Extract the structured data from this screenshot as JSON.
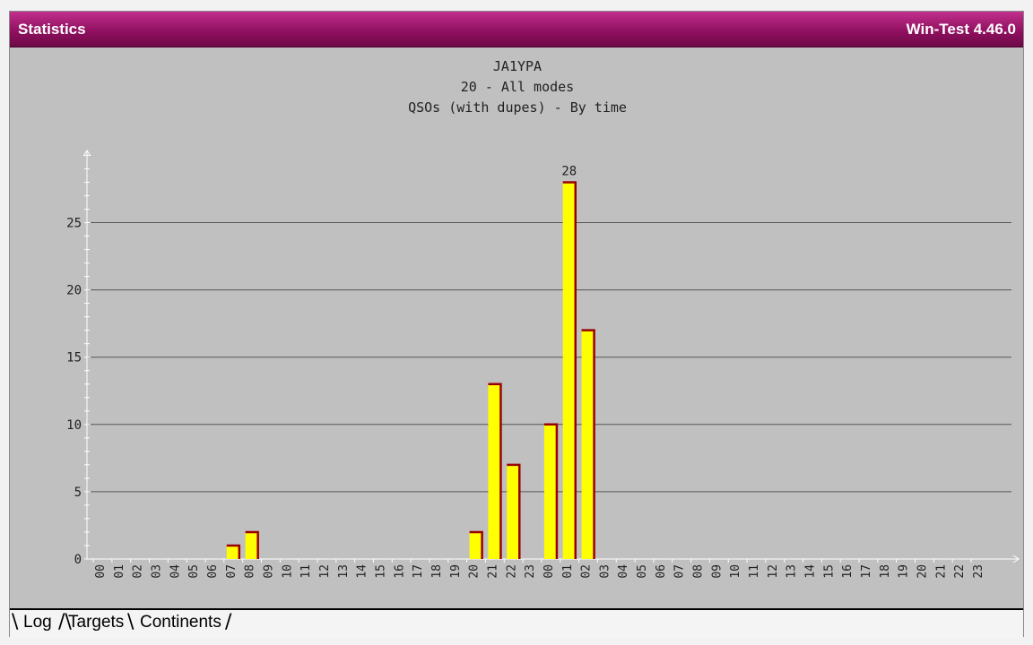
{
  "window": {
    "title": "Statistics",
    "version": "Win-Test 4.46.0"
  },
  "tabs": [
    "Log",
    "Targets",
    "Continents"
  ],
  "colors": {
    "bar_fill": "#ffff00",
    "bar_edge": "#9a0000",
    "background": "#c0c0c0",
    "titlebar": "#a31872"
  },
  "chart_data": {
    "type": "bar",
    "title_lines": [
      "JA1YPA",
      "20 - All modes",
      "QSOs (with dupes) - By time"
    ],
    "categories": [
      "00",
      "01",
      "02",
      "03",
      "04",
      "05",
      "06",
      "07",
      "08",
      "09",
      "10",
      "11",
      "12",
      "13",
      "14",
      "15",
      "16",
      "17",
      "18",
      "19",
      "20",
      "21",
      "22",
      "23",
      "00",
      "01",
      "02",
      "03",
      "04",
      "05",
      "06",
      "07",
      "08",
      "09",
      "10",
      "11",
      "12",
      "13",
      "14",
      "15",
      "16",
      "17",
      "18",
      "19",
      "20",
      "21",
      "22",
      "23"
    ],
    "values": [
      0,
      0,
      0,
      0,
      0,
      0,
      0,
      1,
      2,
      0,
      0,
      0,
      0,
      0,
      0,
      0,
      0,
      0,
      0,
      0,
      2,
      13,
      7,
      0,
      10,
      28,
      17,
      0,
      0,
      0,
      0,
      0,
      0,
      0,
      0,
      0,
      0,
      0,
      0,
      0,
      0,
      0,
      0,
      0,
      0,
      0,
      0,
      0
    ],
    "y_ticks": [
      "0",
      "5",
      "10",
      "15",
      "20",
      "25"
    ],
    "peak_label": "28",
    "ylim": [
      0,
      30
    ],
    "grid": true
  }
}
